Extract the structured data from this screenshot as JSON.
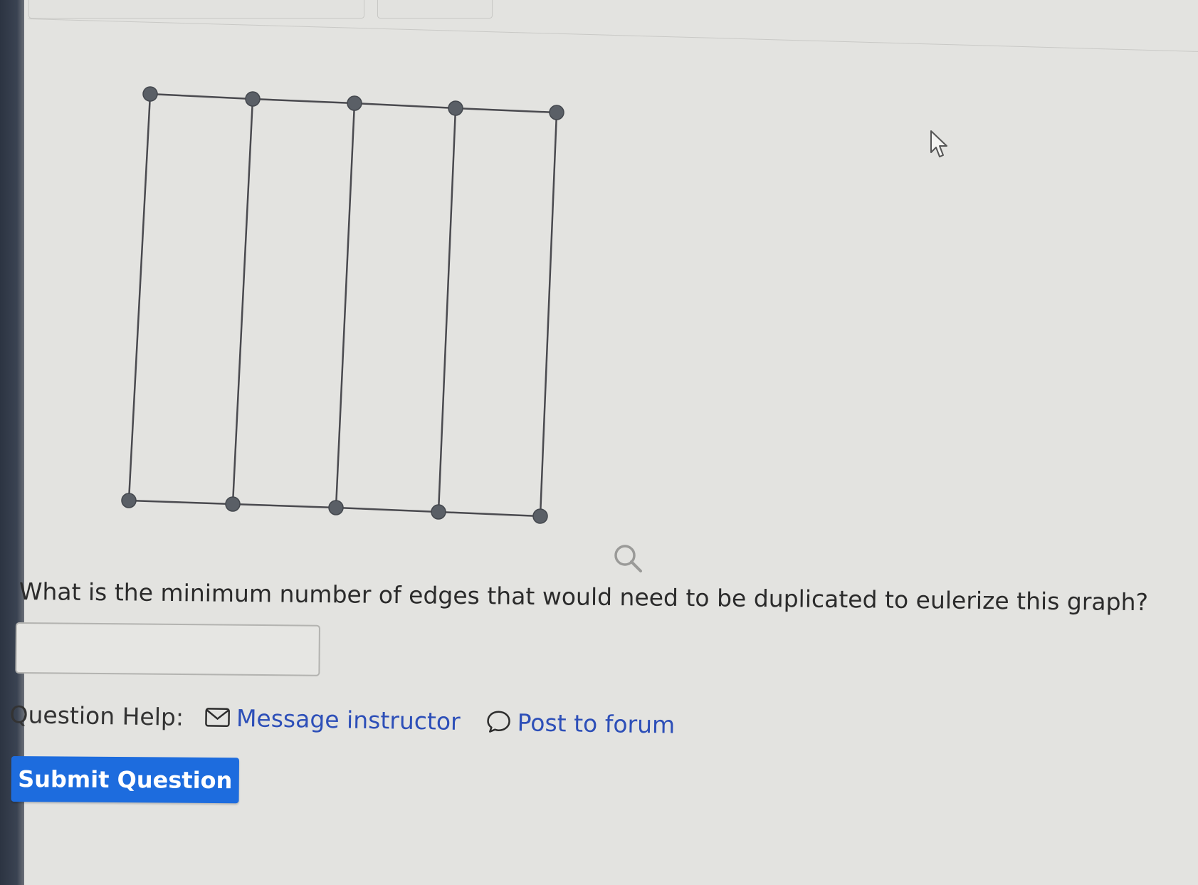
{
  "question": {
    "text": "What is the minimum number of edges that would need to be duplicated to eulerize this graph?",
    "answer_value": ""
  },
  "help": {
    "label": "Question Help:",
    "message_link": "Message instructor",
    "forum_link": "Post to forum"
  },
  "submit": {
    "label": "Submit Question"
  },
  "graph": {
    "vertex_count": 10,
    "edge_count": 13,
    "layout": "2 rows x 5 columns grid"
  },
  "icons": [
    "envelope-icon",
    "speech-bubble-icon",
    "magnifier-icon",
    "mouse-cursor-icon"
  ],
  "colors": {
    "background": "#e3e3e0",
    "link": "#2d4fb8",
    "button": "#1d6cde",
    "vertex": "#5a5f66",
    "edge": "#4a4a4f"
  }
}
